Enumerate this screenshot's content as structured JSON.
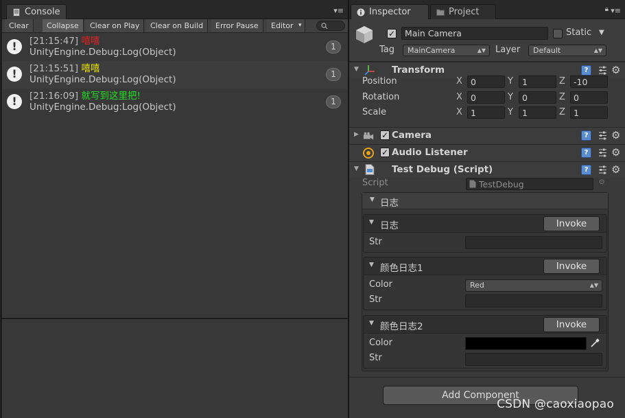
{
  "console": {
    "tab_title": "Console",
    "tab_icon": "console-icon",
    "menu_icon": "panel-menu-icon",
    "toolbar": {
      "clear": "Clear",
      "collapse": "Collapse",
      "clear_on_play": "Clear on Play",
      "clear_on_build": "Clear on Build",
      "error_pause": "Error Pause",
      "editor": "Editor",
      "editor_arrow": "▾",
      "search_icon": "search-icon"
    },
    "logs": [
      {
        "timestamp": "[21:15:47]",
        "message": "嘻嘻",
        "color": "#e02020",
        "stack": "UnityEngine.Debug:Log(Object)",
        "count": "1"
      },
      {
        "timestamp": "[21:15:51]",
        "message": "嘻嘻",
        "color": "#e6e000",
        "stack": "UnityEngine.Debug:Log(Object)",
        "count": "1"
      },
      {
        "timestamp": "[21:16:09]",
        "message": "就写到这里把!",
        "color": "#22e022",
        "stack": "UnityEngine.Debug:Log(Object)",
        "count": "1"
      }
    ]
  },
  "inspector": {
    "tab_title": "Inspector",
    "tab_icon": "info-icon",
    "project_tab_title": "Project",
    "project_tab_icon": "folder-icon",
    "gameobject": {
      "active": true,
      "name": "Main Camera",
      "static_label": "Static",
      "tag_label": "Tag",
      "tag_value": "MainCamera",
      "layer_label": "Layer",
      "layer_value": "Default"
    },
    "transform": {
      "title": "Transform",
      "rows": [
        {
          "label": "Position",
          "x": "0",
          "y": "1",
          "z": "-10"
        },
        {
          "label": "Rotation",
          "x": "0",
          "y": "0",
          "z": "0"
        },
        {
          "label": "Scale",
          "x": "1",
          "y": "1",
          "z": "1"
        }
      ],
      "axis_x": "X",
      "axis_y": "Y",
      "axis_z": "Z"
    },
    "camera": {
      "title": "Camera",
      "enabled": true
    },
    "audio_listener": {
      "title": "Audio Listener",
      "enabled": true
    },
    "test_debug": {
      "title": "Test Debug (Script)",
      "script_label": "Script",
      "script_value": "TestDebug",
      "group_label": "日志",
      "events": [
        {
          "name": "日志",
          "invoke": "Invoke",
          "fields": [
            {
              "label": "Str",
              "value": ""
            }
          ]
        },
        {
          "name": "颜色日志1",
          "invoke": "Invoke",
          "fields": [
            {
              "label": "Color",
              "value": "Red"
            },
            {
              "label": "Str",
              "value": ""
            }
          ]
        },
        {
          "name": "颜色日志2",
          "invoke": "Invoke",
          "fields": [
            {
              "label": "Color",
              "value": "#000000"
            },
            {
              "label": "Str",
              "value": ""
            }
          ]
        }
      ]
    },
    "add_component": "Add Component"
  },
  "watermark": "CSDN @caoxiaopao"
}
